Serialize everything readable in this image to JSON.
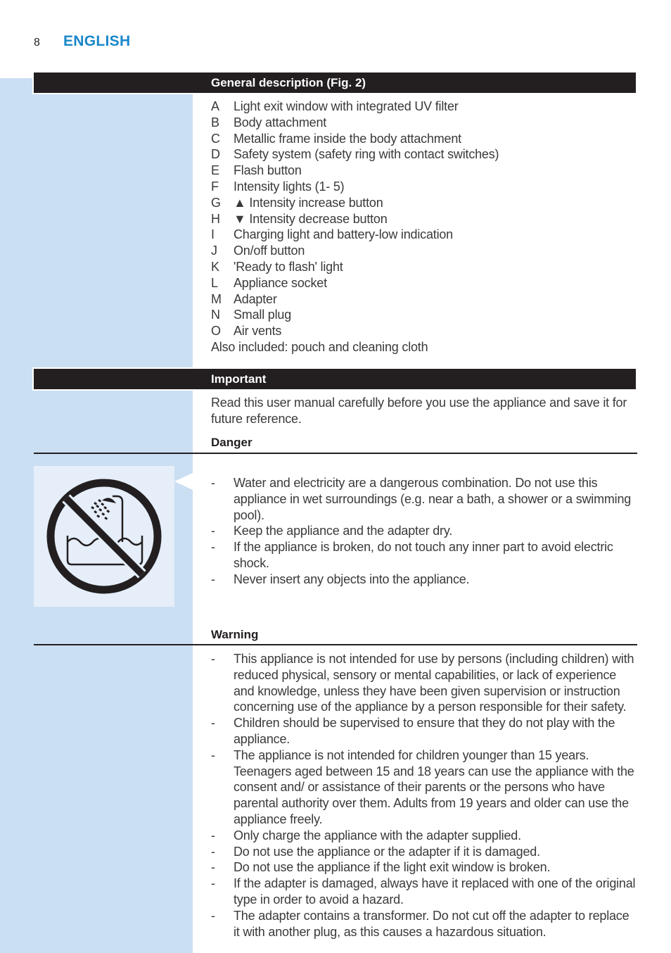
{
  "header": {
    "page_number": "8",
    "language": "ENGLISH"
  },
  "general_description": {
    "title": "General description (Fig. 2)",
    "parts": [
      {
        "letter": "A",
        "label": "Light exit window with integrated UV filter"
      },
      {
        "letter": "B",
        "label": "Body attachment"
      },
      {
        "letter": "C",
        "label": "Metallic frame inside the body attachment"
      },
      {
        "letter": "D",
        "label": "Safety system (safety ring with contact switches)"
      },
      {
        "letter": "E",
        "label": "Flash button"
      },
      {
        "letter": "F",
        "label": "Intensity lights (1- 5)"
      },
      {
        "letter": "G",
        "label": "▲ Intensity increase button"
      },
      {
        "letter": "H",
        "label": "▼ Intensity decrease button"
      },
      {
        "letter": "I",
        "label": "Charging light and battery-low indication"
      },
      {
        "letter": "J",
        "label": "On/off button"
      },
      {
        "letter": "K",
        "label": "'Ready to flash' light"
      },
      {
        "letter": "L",
        "label": "Appliance socket"
      },
      {
        "letter": "M",
        "label": "Adapter"
      },
      {
        "letter": "N",
        "label": "Small plug"
      },
      {
        "letter": "O",
        "label": "Air vents"
      }
    ],
    "also_included": "Also included: pouch and cleaning cloth"
  },
  "important": {
    "title": "Important",
    "intro": "Read this user manual carefully before you use the appliance and save it for future reference.",
    "danger": {
      "heading": "Danger",
      "icon": "no-water-bath-shower-icon",
      "bullet_symbol": "-",
      "items": [
        "Water and electricity are a dangerous combination. Do not use this appliance in wet surroundings (e.g. near a bath, a shower or a swimming pool).",
        "Keep the appliance and the adapter dry.",
        "If the appliance is broken, do not touch any inner part to avoid electric shock.",
        "Never insert any objects into the appliance."
      ]
    },
    "warning": {
      "heading": "Warning",
      "bullet_symbol": "-",
      "items": [
        "This appliance is not intended for use by persons (including children) with reduced physical, sensory or mental capabilities, or lack of experience and knowledge, unless they have been given supervision or instruction concerning use of the appliance by a person responsible for their safety.",
        "Children should be supervised to ensure that they do not play with the appliance.",
        "The appliance is not intended for children younger than 15 years. Teenagers aged between 15 and 18 years can use the appliance with the consent and/ or assistance of their parents or the persons who have parental authority over them. Adults from 19 years and older can use the appliance freely.",
        "Only charge the appliance with the adapter supplied.",
        "Do not use the appliance or the adapter if it is damaged.",
        "Do not use the appliance if the light exit window is broken.",
        "If the adapter is damaged, always have it replaced with one of the original type in order to avoid a hazard.",
        "The adapter contains a transformer. Do not cut off the adapter to replace it with another plug, as this causes a hazardous situation."
      ]
    }
  },
  "colors": {
    "accent_blue": "#1a87c9",
    "sidebar_blue": "#cbdff3",
    "icon_box_blue": "#e5eef9",
    "bar_black": "#231f20"
  }
}
